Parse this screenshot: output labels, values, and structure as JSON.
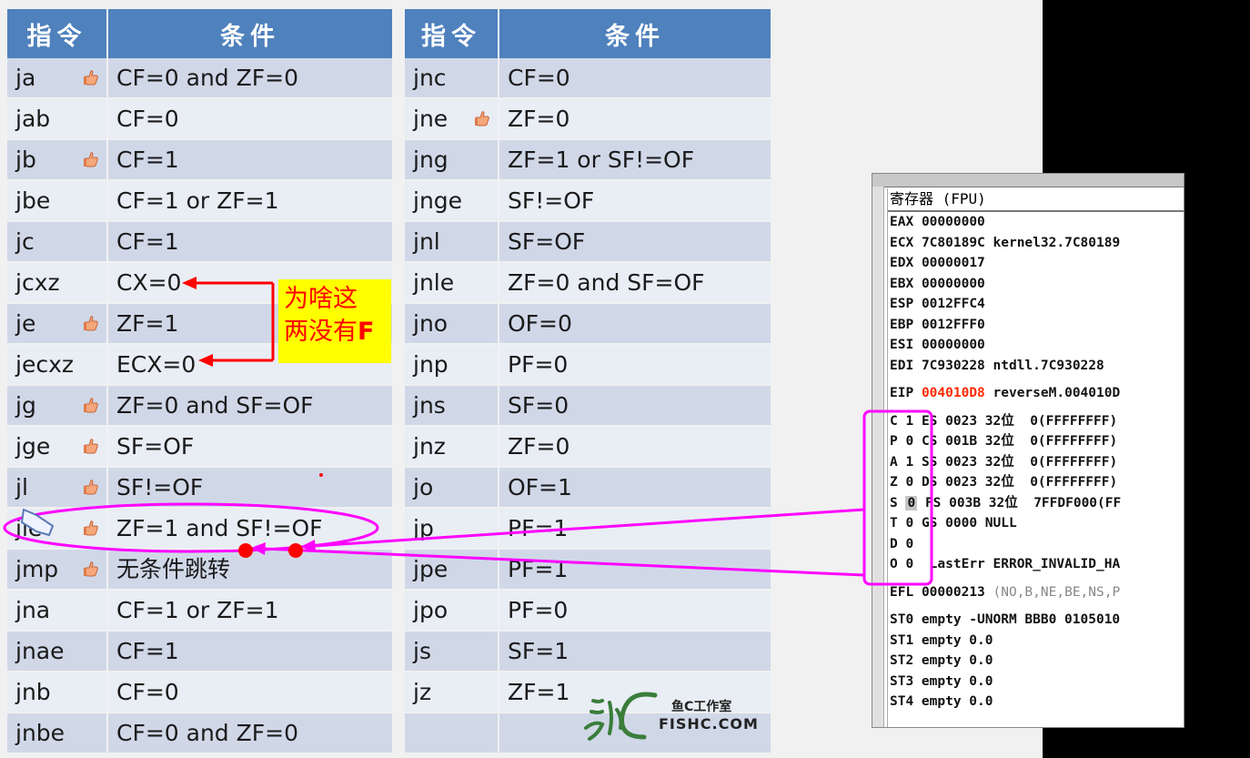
{
  "table": {
    "headers": [
      "指令",
      "条件",
      "指令",
      "条件"
    ],
    "rows": [
      {
        "ins1": "ja",
        "thumb1": true,
        "cond1": "CF=0 and ZF=0",
        "ins2": "jnc",
        "thumb2": false,
        "cond2": "CF=0"
      },
      {
        "ins1": "jab",
        "thumb1": false,
        "cond1": "CF=0",
        "ins2": "jne",
        "thumb2": true,
        "cond2": "ZF=0"
      },
      {
        "ins1": "jb",
        "thumb1": true,
        "cond1": "CF=1",
        "ins2": "jng",
        "thumb2": false,
        "cond2": "ZF=1 or SF!=OF"
      },
      {
        "ins1": "jbe",
        "thumb1": false,
        "cond1": "CF=1 or ZF=1",
        "ins2": "jnge",
        "thumb2": false,
        "cond2": "SF!=OF"
      },
      {
        "ins1": "jc",
        "thumb1": false,
        "cond1": "CF=1",
        "ins2": "jnl",
        "thumb2": false,
        "cond2": "SF=OF"
      },
      {
        "ins1": "jcxz",
        "thumb1": false,
        "cond1": "CX=0",
        "ins2": "jnle",
        "thumb2": false,
        "cond2": "ZF=0 and SF=OF"
      },
      {
        "ins1": "je",
        "thumb1": true,
        "cond1": "ZF=1",
        "ins2": "jno",
        "thumb2": false,
        "cond2": "OF=0"
      },
      {
        "ins1": "jecxz",
        "thumb1": false,
        "cond1": "ECX=0",
        "ins2": "jnp",
        "thumb2": false,
        "cond2": "PF=0"
      },
      {
        "ins1": "jg",
        "thumb1": true,
        "cond1": "ZF=0 and SF=OF",
        "ins2": "jns",
        "thumb2": false,
        "cond2": "SF=0"
      },
      {
        "ins1": "jge",
        "thumb1": true,
        "cond1": "SF=OF",
        "ins2": "jnz",
        "thumb2": false,
        "cond2": "ZF=0"
      },
      {
        "ins1": "jl",
        "thumb1": true,
        "cond1": "SF!=OF",
        "ins2": "jo",
        "thumb2": false,
        "cond2": "OF=1"
      },
      {
        "ins1": "jle",
        "thumb1": true,
        "cond1": "ZF=1 and SF!=OF",
        "ins2": "jp",
        "thumb2": false,
        "cond2": "PF=1"
      },
      {
        "ins1": "jmp",
        "thumb1": true,
        "cond1": "无条件跳转",
        "ins2": "jpe",
        "thumb2": false,
        "cond2": "PF=1"
      },
      {
        "ins1": "jna",
        "thumb1": false,
        "cond1": "CF=1 or ZF=1",
        "ins2": "jpo",
        "thumb2": false,
        "cond2": "PF=0"
      },
      {
        "ins1": "jnae",
        "thumb1": false,
        "cond1": "CF=1",
        "ins2": "js",
        "thumb2": false,
        "cond2": "SF=1"
      },
      {
        "ins1": "jnb",
        "thumb1": false,
        "cond1": "CF=0",
        "ins2": "jz",
        "thumb2": false,
        "cond2": "ZF=1"
      },
      {
        "ins1": "jnbe",
        "thumb1": false,
        "cond1": "CF=0 and ZF=0",
        "ins2": "",
        "thumb2": false,
        "cond2": ""
      }
    ]
  },
  "note": {
    "line1": "为啥这",
    "line2_text": "两没有",
    "line2_bold": "F"
  },
  "logo": {
    "cn": "鱼C工作室",
    "en": "FISHC.COM"
  },
  "registers": {
    "title": "寄存器 (FPU)",
    "general": [
      {
        "name": "EAX",
        "value": "00000000",
        "comment": ""
      },
      {
        "name": "ECX",
        "value": "7C80189C",
        "comment": "kernel32.7C80189"
      },
      {
        "name": "EDX",
        "value": "00000017",
        "comment": ""
      },
      {
        "name": "EBX",
        "value": "00000000",
        "comment": ""
      },
      {
        "name": "ESP",
        "value": "0012FFC4",
        "comment": ""
      },
      {
        "name": "EBP",
        "value": "0012FFF0",
        "comment": ""
      },
      {
        "name": "ESI",
        "value": "00000000",
        "comment": ""
      },
      {
        "name": "EDI",
        "value": "7C930228",
        "comment": "ntdll.7C930228"
      }
    ],
    "eip": {
      "name": "EIP",
      "value": "004010D8",
      "comment": "reverseM.004010D"
    },
    "flags": [
      {
        "flag": "C",
        "bit": "1",
        "seg": "ES 0023 32位  0(FFFFFFFF)"
      },
      {
        "flag": "P",
        "bit": "0",
        "seg": "CS 001B 32位  0(FFFFFFFF)"
      },
      {
        "flag": "A",
        "bit": "1",
        "seg": "SS 0023 32位  0(FFFFFFFF)"
      },
      {
        "flag": "Z",
        "bit": "0",
        "seg": "DS 0023 32位  0(FFFFFFFF)"
      },
      {
        "flag": "S",
        "bit": "0",
        "seg": "FS 003B 32位  7FFDF000(FF"
      },
      {
        "flag": "T",
        "bit": "0",
        "seg": "GS 0000 NULL"
      },
      {
        "flag": "D",
        "bit": "0",
        "seg": ""
      },
      {
        "flag": "O",
        "bit": "0",
        "seg": " LastErr ERROR_INVALID_HA"
      }
    ],
    "efl": {
      "name": "EFL",
      "value": "00000213",
      "comment": "(NO,B,NE,BE,NS,P"
    },
    "fpu": [
      "ST0 empty -UNORM BBB0 0105010",
      "ST1 empty 0.0",
      "ST2 empty 0.0",
      "ST3 empty 0.0",
      "ST4 empty 0.0"
    ]
  },
  "colors": {
    "header": "#4f81bd",
    "row_odd": "#d0d8e8",
    "row_even": "#e9edf4",
    "annotation": "#ff00ff",
    "red_arrow": "#ff0000",
    "note_bg": "#ffff00"
  }
}
